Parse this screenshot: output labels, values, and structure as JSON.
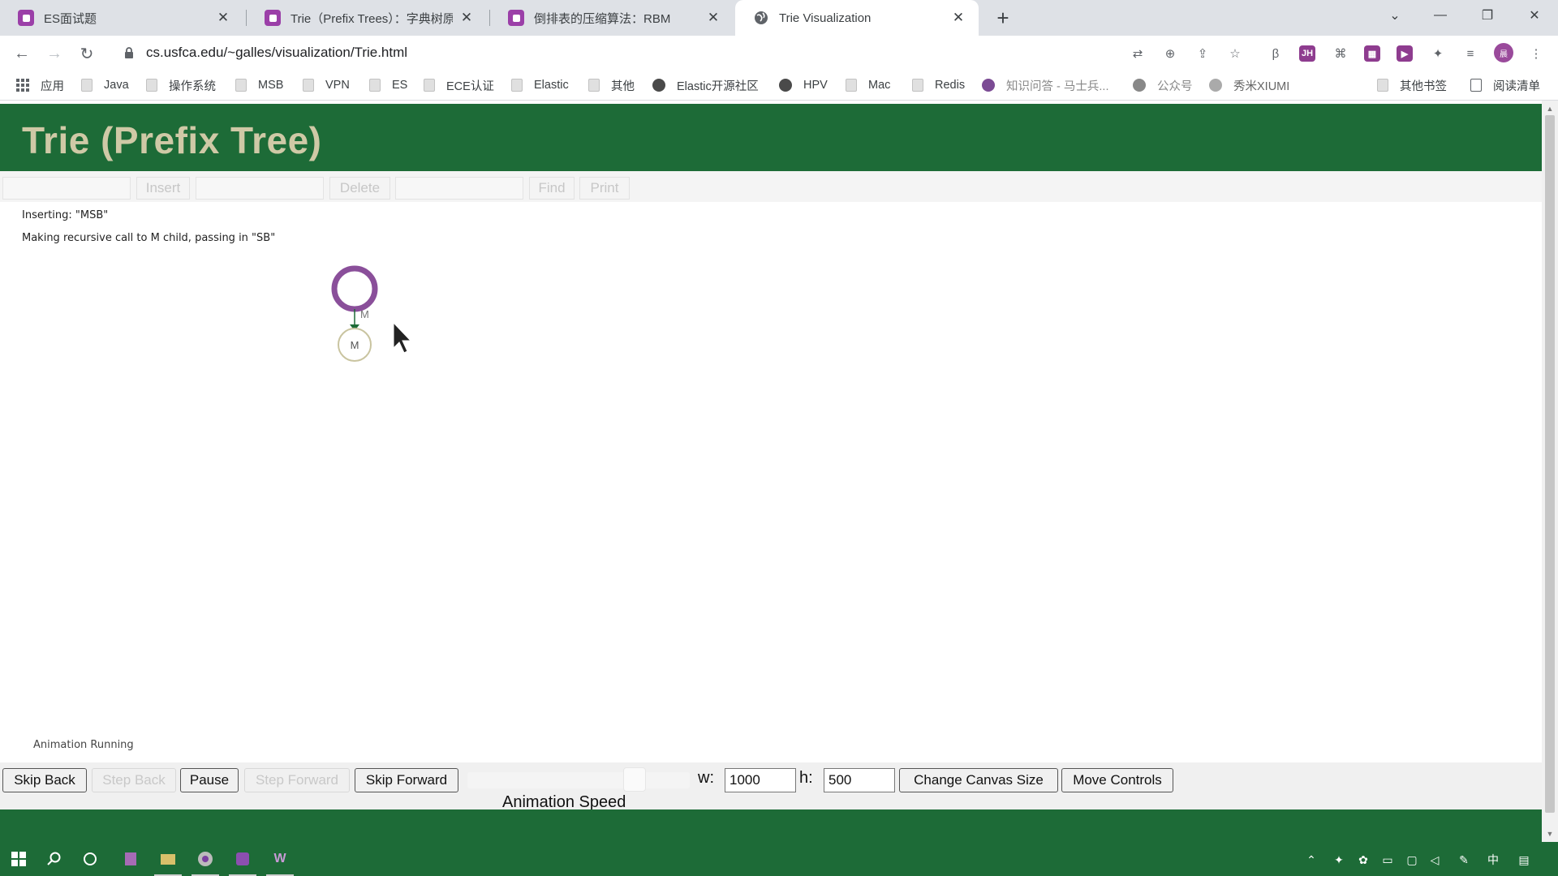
{
  "browser": {
    "tabs": [
      {
        "title": "ES面试题",
        "icon": "purple-page-icon"
      },
      {
        "title": "Trie（Prefix Trees）：字典树原",
        "icon": "purple-page-icon"
      },
      {
        "title": "倒排表的压缩算法：RBM",
        "icon": "purple-page-icon"
      },
      {
        "title": "Trie Visualization",
        "icon": "globe-icon"
      }
    ],
    "url": "cs.usfca.edu/~galles/visualization/Trie.html",
    "avatar_initial": "晨",
    "bookmarks": [
      {
        "label": "应用",
        "icon": "apps-grid-icon"
      },
      {
        "label": "Java",
        "icon": "folder-icon"
      },
      {
        "label": "操作系统",
        "icon": "folder-icon"
      },
      {
        "label": "MSB",
        "icon": "folder-icon"
      },
      {
        "label": "VPN",
        "icon": "folder-icon"
      },
      {
        "label": "ES",
        "icon": "folder-icon"
      },
      {
        "label": "ECE认证",
        "icon": "folder-icon"
      },
      {
        "label": "Elastic",
        "icon": "folder-icon"
      },
      {
        "label": "其他",
        "icon": "folder-icon"
      },
      {
        "label": "Elastic开源社区",
        "icon": "globe-icon"
      },
      {
        "label": "HPV",
        "icon": "globe-icon"
      },
      {
        "label": "Mac",
        "icon": "folder-icon"
      },
      {
        "label": "Redis",
        "icon": "folder-icon"
      },
      {
        "label": "知识问答 - 马士兵...",
        "icon": "site-icon"
      },
      {
        "label": "公众号",
        "icon": "site-icon"
      },
      {
        "label": "秀米XIUMI",
        "icon": "site-icon"
      }
    ],
    "other_bookmarks": "其他书签",
    "reading_list": "阅读清单"
  },
  "page": {
    "title": "Trie (Prefix Tree)",
    "controls": {
      "insert_label": "Insert",
      "delete_label": "Delete",
      "find_label": "Find",
      "print_label": "Print"
    },
    "messages": [
      "Inserting: \"MSB\"",
      "Making recursive call to M child, passing in \"SB\""
    ],
    "tree": {
      "root_label": "",
      "edge_label": "M",
      "child_label": "M"
    },
    "animation_status": "Animation Running",
    "animation_controls": {
      "skip_back": "Skip Back",
      "step_back": "Step Back",
      "pause": "Pause",
      "step_forward": "Step Forward",
      "skip_forward": "Skip Forward",
      "speed_label": "Animation Speed",
      "w_label": "w:",
      "w_value": "1000",
      "h_label": "h:",
      "h_value": "500",
      "change_canvas": "Change Canvas Size",
      "move_controls": "Move Controls"
    }
  },
  "taskbar": {
    "ime": "中"
  },
  "colors": {
    "header_green": "#1d6b37",
    "title_text": "#cfc9a6",
    "highlight_circle": "#8a4f9a"
  }
}
